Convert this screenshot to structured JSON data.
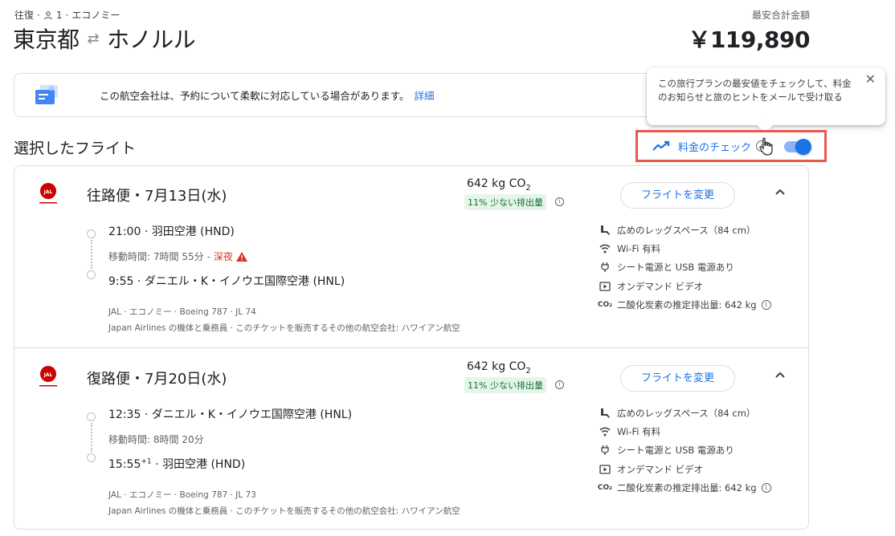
{
  "header": {
    "trip_type": "往復",
    "passengers": "1",
    "cabin": "エコノミー",
    "origin": "東京都",
    "destination": "ホノルル",
    "price_label": "最安合計金額",
    "price": "￥119,890"
  },
  "notice": {
    "text": "この航空会社は、予約について柔軟に対応している場合があります。",
    "link": "詳細"
  },
  "tooltip": {
    "text": "この旅行プランの最安値をチェックして、料金のお知らせと旅のヒントをメールで受け取る"
  },
  "section_title": "選択したフライト",
  "price_tracking": {
    "label": "料金のチェック",
    "enabled": true
  },
  "flights": [
    {
      "title": "往路便・7月13日(水)",
      "co2_value": "642 kg CO",
      "co2_sub": "2",
      "co2_badge": "11% 少ない排出量",
      "change_label": "フライトを変更",
      "depart_time": "21:00",
      "depart_time_sup": "",
      "depart_airport": "羽田空港 (HND)",
      "duration": "移動時間: 7時間 55分",
      "overnight": "深夜",
      "arrive_time": "9:55",
      "arrive_time_sup": "",
      "arrive_airport": "ダニエル・K・イノウエ国際空港 (HNL)",
      "detail_line1": "JAL · エコノミー · Boeing 787 · JL 74",
      "detail_line2": "Japan Airlines の機体と乗務員 · このチケットを販売するその他の航空会社: ハワイアン航空",
      "amenities": [
        "広めのレッグスペース（84 cm）",
        "Wi-Fi 有料",
        "シート電源と USB 電源あり",
        "オンデマンド ビデオ",
        "二酸化炭素の推定排出量: 642 kg"
      ]
    },
    {
      "title": "復路便・7月20日(水)",
      "co2_value": "642 kg CO",
      "co2_sub": "2",
      "co2_badge": "11% 少ない排出量",
      "change_label": "フライトを変更",
      "depart_time": "12:35",
      "depart_time_sup": "",
      "depart_airport": "ダニエル・K・イノウエ国際空港 (HNL)",
      "duration": "移動時間: 8時間 20分",
      "overnight": "",
      "arrive_time": "15:55",
      "arrive_time_sup": "+1",
      "arrive_airport": "羽田空港 (HND)",
      "detail_line1": "JAL · エコノミー · Boeing 787 · JL 73",
      "detail_line2": "Japan Airlines の機体と乗務員 · このチケットを販売するその他の航空会社: ハワイアン航空",
      "amenities": [
        "広めのレッグスペース（84 cm）",
        "Wi-Fi 有料",
        "シート電源と USB 電源あり",
        "オンデマンド ビデオ",
        "二酸化炭素の推定排出量: 642 kg"
      ]
    }
  ],
  "icons": {
    "legroom": "legroom-icon",
    "wifi": "wifi-icon",
    "power": "power-plug-icon",
    "video": "video-icon",
    "co2": "co2-icon"
  },
  "colors": {
    "accent": "#1a73e8",
    "highlight_border": "#e8584d",
    "badge_bg": "#e6f4ea",
    "badge_text": "#137333",
    "warning": "#d93025"
  }
}
